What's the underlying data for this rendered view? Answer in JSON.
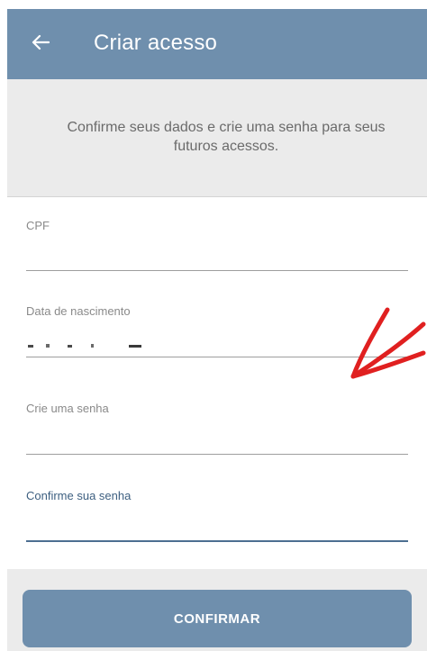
{
  "appbar": {
    "title": "Criar acesso",
    "back_icon": "arrow-left-icon",
    "color": "#6f8fad"
  },
  "info": {
    "message": "Confirme seus dados e crie uma senha para seus futuros acessos."
  },
  "form": {
    "cpf": {
      "label": "CPF",
      "value": ""
    },
    "birthdate": {
      "label": "Data de nascimento",
      "value": ""
    },
    "password": {
      "label": "Crie uma senha",
      "value": ""
    },
    "confirm_password": {
      "label": "Confirme sua senha",
      "value": ""
    }
  },
  "annotation": {
    "icon": "red-arrow-icon",
    "color": "#e02020"
  },
  "actions": {
    "confirm_label": "CONFIRMAR"
  }
}
